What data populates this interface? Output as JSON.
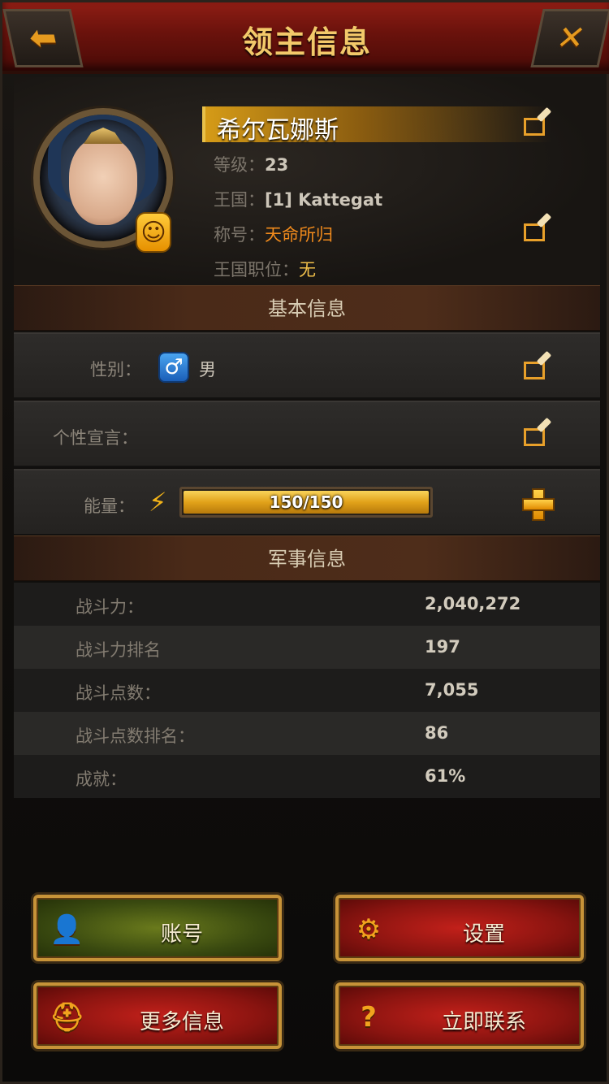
{
  "header": {
    "title": "领主信息",
    "back_icon": "back-arrow-icon",
    "close_icon": "close-icon"
  },
  "profile": {
    "name": "希尔瓦娜斯",
    "level_label": "等级：",
    "level": "23",
    "kingdom_label": "王国：",
    "kingdom": "[1] Kattegat",
    "title_label": "称号：",
    "title": "天命所归",
    "position_label": "王国职位：",
    "position": "无",
    "badge_icon": "smiley-badge-icon"
  },
  "basic": {
    "header": "基本信息",
    "gender_label": "性别：",
    "gender": "男",
    "gender_icon": "male-icon",
    "motto_label": "个性宣言：",
    "energy_label": "能量：",
    "energy_text": "150/150",
    "energy_fraction": 1.0
  },
  "military": {
    "header": "军事信息",
    "rows": [
      {
        "label": "战斗力：",
        "value": "2,040,272"
      },
      {
        "label": "战斗力排名",
        "value": "197"
      },
      {
        "label": "战斗点数：",
        "value": "7,055"
      },
      {
        "label": "战斗点数排名：",
        "value": "86"
      },
      {
        "label": "成就：",
        "value": "61%"
      }
    ]
  },
  "buttons": {
    "account": "账号",
    "settings": "设置",
    "more_info": "更多信息",
    "contact": "立即联系"
  },
  "colors": {
    "accent_gold": "#f3c96a",
    "title_orange": "#f08a1c",
    "title_red": "#8e1d14"
  }
}
